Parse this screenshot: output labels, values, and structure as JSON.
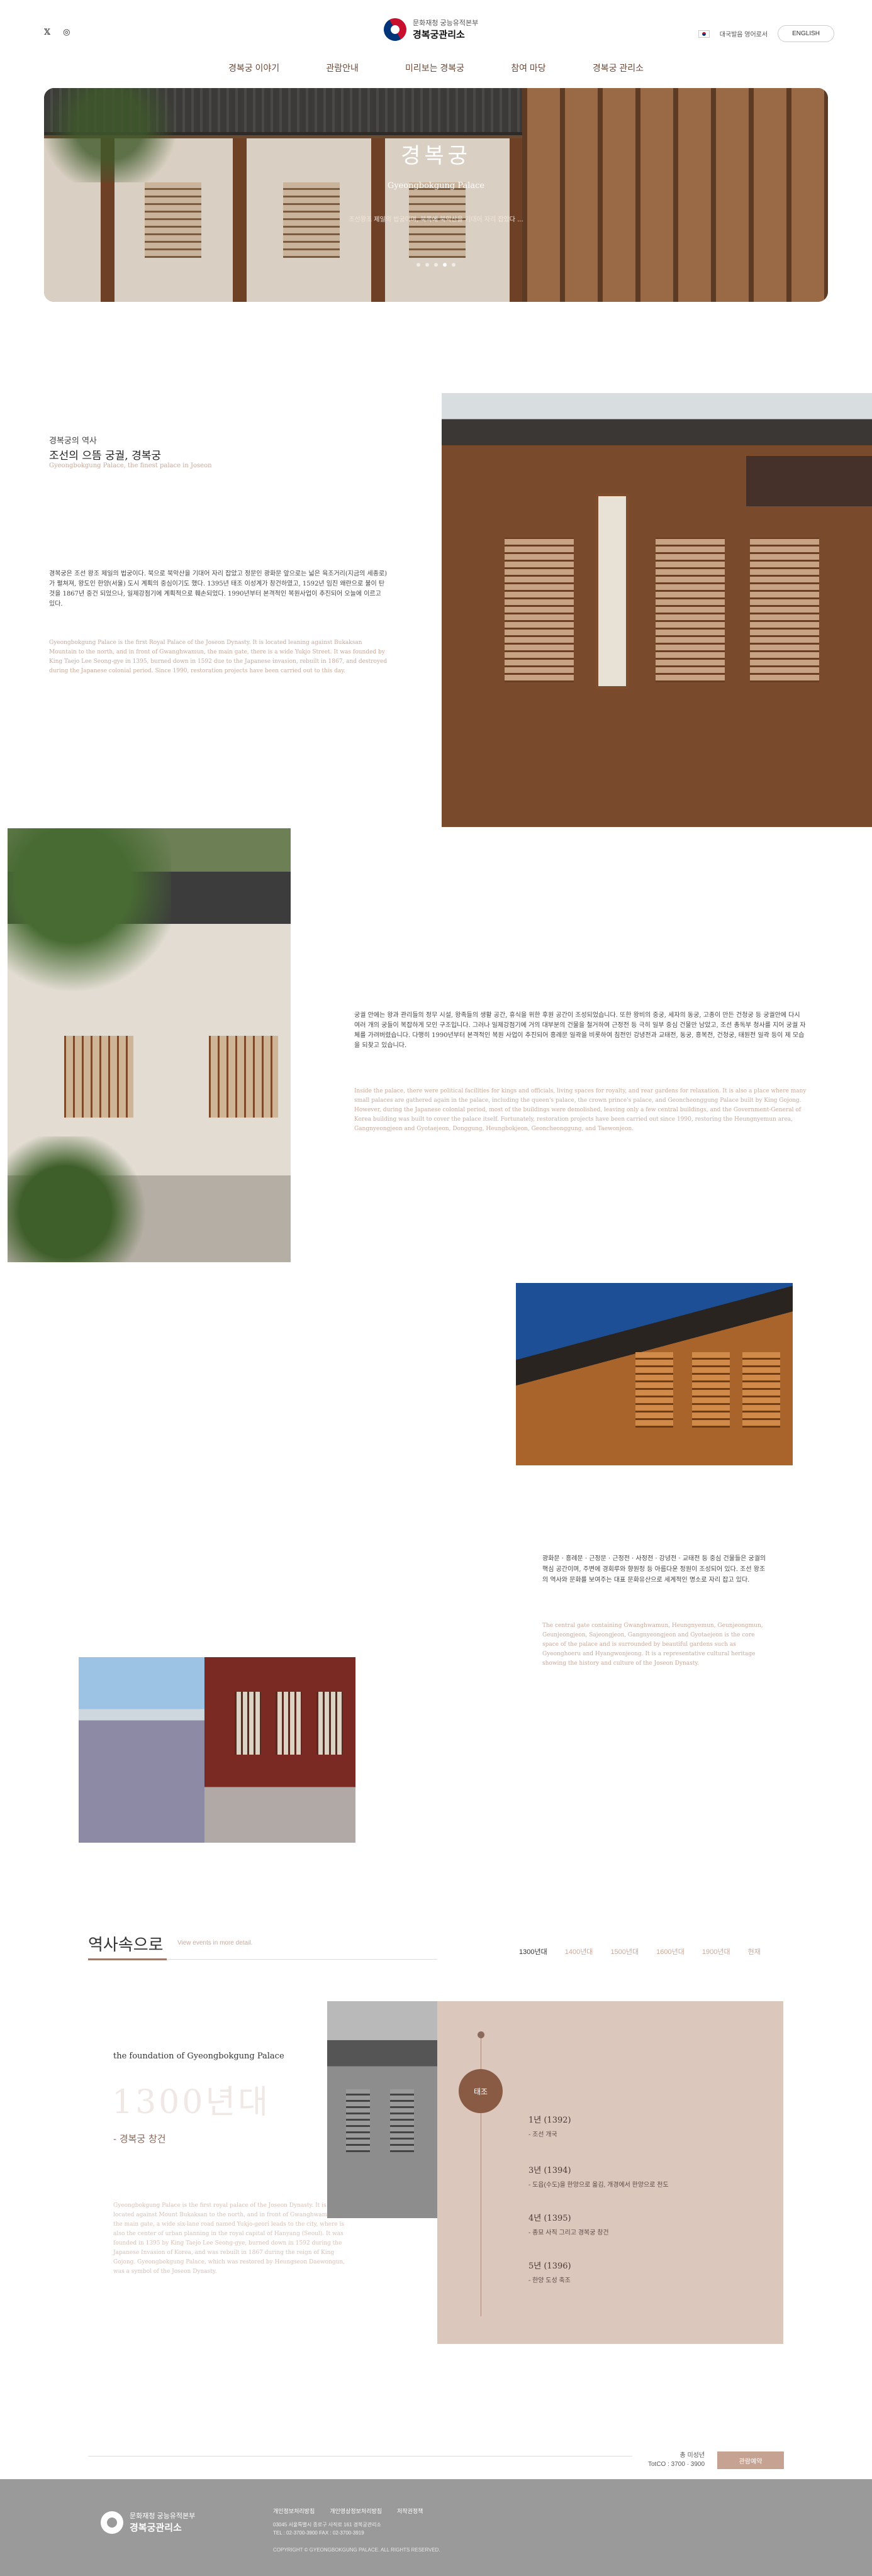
{
  "header": {
    "social": {
      "twitter": "twitter-icon",
      "instagram": "instagram-icon"
    },
    "logo_sub": "문화재청 궁능유적본부",
    "logo_main": "경복궁관리소",
    "lang_link": "대국발음 영어로서",
    "english_button": "ENGLISH",
    "nav": [
      "경복궁 이야기",
      "관람안내",
      "미리보는 경복궁",
      "참여 마당",
      "경복궁 관리소"
    ]
  },
  "hero": {
    "title": "경복궁",
    "subtitle": "Gyeongbokgung Palace",
    "description": "조선왕조 제일의 법궁이며, 북쪽에 북악산을 기대어 자리 잡았다 ...",
    "slides": 5,
    "active_slide": 3
  },
  "intro": {
    "label": "경복궁의 역사",
    "title": "조선의 으뜸 궁궐, 경복궁",
    "subtitle_en": "Gyeongbokgung Palace, the finest palace in Joseon",
    "body_ko": "경복궁은 조선 왕조 제일의 법궁이다. 북으로 북악산을 기대어 자리 잡았고 정문인 광화문 앞으로는 넓은 육조거리(지금의 세종로)가 펼쳐져, 왕도인 한양(서울) 도시 계획의 중심이기도 했다. 1395년 태조 이성계가 창건하였고, 1592년 임진 왜란으로 불이 탄 것을 1867년 중건 되었으나, 일제강점기에 계획적으로 훼손되었다. 1990년부터 본격적인 복원사업이 추진되어 오늘에 이르고 있다.",
    "body_en": "Gyeongbokgung Palace is the first Royal Palace of the Joseon Dynasty. It is located leaning against Bukaksan Mountain to the north, and in front of Gwanghwamun, the main gate, there is a wide Yukjo Street. It was founded by King Taejo Lee Seong-gye in 1395, burned down in 1592 due to the Japanese invasion, rebuilt in 1867, and destroyed during the Japanese colonial period. Since 1990, restoration projects have been carried out to this day."
  },
  "section2": {
    "body_ko": "궁궐 안에는 왕과 관리들의 정무 시설, 왕족들의 생활 공간, 휴식을 위한 후원 공간이 조성되었습니다. 또한 왕비의 중궁, 세자의 동궁, 고종이 만든 건청궁 등 궁궐안에 다시 여러 개의 궁들이 복잡하게 모인 구조입니다. 그러나 일제강점기에 거의 대부분의 건물을 철거하여 근정전 등 극히 일부 중심 건물만 남았고, 조선 총독부 청사를 지어 궁궐 자체를 가려버렸습니다. 다행히 1990년부터 본격적인 복원 사업이 추진되어 흥례문 일곽을 비롯하여 침전인 강녕전과 교태전, 동궁, 흥복전, 건청궁, 태원전 일곽 등이 제 모습을 되찾고 있습니다.",
    "body_en": "Inside the palace, there were political facilities for kings and officials, living spaces for royalty, and rear gardens for relaxation. It is also a place where many small palaces are gathered again in the palace, including the queen's palace, the crown prince's palace, and Geoncheonggung Palace built by King Gojong. However, during the Japanese colonial period, most of the buildings were demolished, leaving only a few central buildings, and the Government-General of Korea building was built to cover the palace itself. Fortunately, restoration projects have been carried out since 1990, restoring the Heungnyemun area, Gangnyeongjeon and Gyotaejeon, Donggung, Heungbokjeon, Geoncheonggung, and Taewonjeon."
  },
  "section3": {
    "body_ko": "광화문 · 흥례문 · 근정문 · 근정전 · 사정전 · 강녕전 · 교태전 등 중심 건물들은 궁궐의 핵심 공간이며, 주변에 경회루와 향원정 등 아름다운 정원이 조성되어 있다. 조선 왕조의 역사와 문화를 보여주는 대표 문화유산으로 세계적인 명소로 자리 잡고 있다.",
    "body_en": "The central gate containing Gwanghwamun, Heungnyemun, Geunjeongmun, Geunjeongjeon, Sajeongjeon, Gangnyeongjeon and Gyotaejeon is the core space of the palace and is surrounded by beautiful gardens such as Gyeonghoeru and Hyangwonjeong. It is a representative cultural heritage showing the history and culture of the Joseon Dynasty."
  },
  "history": {
    "title": "역사속으로",
    "subtitle": "View events in more detail.",
    "tabs": [
      "1300년대",
      "1400년대",
      "1500년대",
      "1600년대",
      "1900년대",
      "현재"
    ],
    "active_tab": 0,
    "period_en": "the foundation of Gyeongbokgung Palace",
    "era": "1300년대",
    "era_name": "- 경복궁 창건",
    "description": "Gyeongbokgung Palace is the first royal palace of the Joseon Dynasty. It is located against Mount Bukaksan to the north, and in front of Gwanghwamun, the main gate, a wide six-lane road named Yukjo-geori leads to the city, where is also the center of urban planning in the royal capital of Hanyang (Seoul). It was founded in 1395 by King Taejo Lee Seong-gye, burned down in 1592 during the Japanese Invasion of Korea, and was rebuilt in 1867 during the reign of King Gojong. Gyeongbokgung Palace, which was restored by Heungseon Daewongun, was a symbol of the Joseon Dynasty.",
    "badge": "태조",
    "events": [
      {
        "year": "1년 (1392)",
        "text": "- 조선 개국"
      },
      {
        "year": "3년 (1394)",
        "text": "- 도읍(수도)을 한양으로 옮김, 개경에서 한양으로 천도"
      },
      {
        "year": "4년 (1395)",
        "text": "- 종묘 사직 그리고 경복궁 창건"
      },
      {
        "year": "5년 (1396)",
        "text": "- 한양 도성 축조"
      }
    ]
  },
  "visitors": {
    "label": "총 미성년",
    "value": "TotCO : 3700 · 3900",
    "button": "관람예약"
  },
  "footer": {
    "logo_sub": "문화재청 궁능유적본부",
    "logo_main": "경복궁관리소",
    "links": [
      "개인정보처리방침",
      "개인영상정보처리방침",
      "저작권정책"
    ],
    "address": "03045 서울특별시 종로구 사직로 161 경복궁관리소",
    "phone": "TEL : 02-3700-3900   FAX : 02-3700-3919",
    "copyright": "COPYRIGHT © GYEONGBOKGUNG PALACE. ALL RIGHTS RESERVED."
  }
}
